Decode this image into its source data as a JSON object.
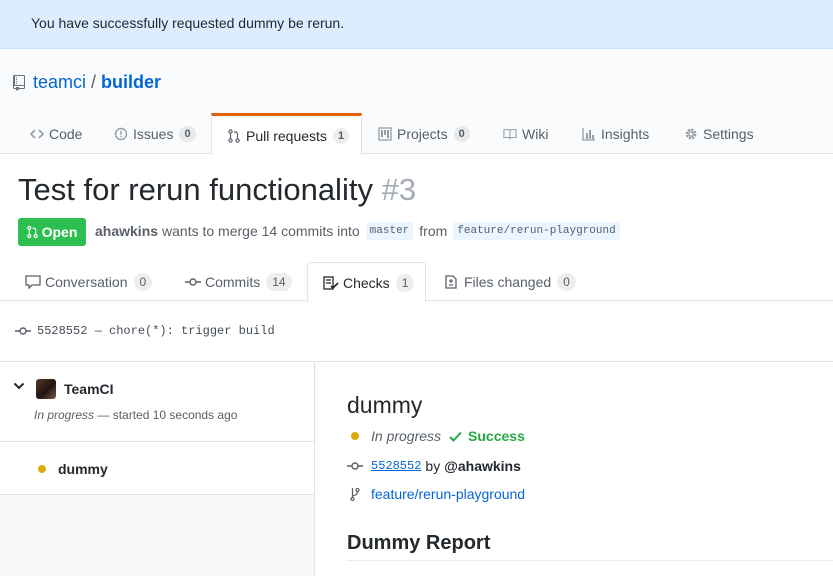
{
  "flash": {
    "message": "You have successfully requested dummy be rerun."
  },
  "repo": {
    "owner": "teamci",
    "separator": "/",
    "name": "builder"
  },
  "repo_nav": [
    {
      "label": "Code",
      "icon": "code-icon",
      "count": ""
    },
    {
      "label": "Issues",
      "icon": "issue-icon",
      "count": "0"
    },
    {
      "label": "Pull requests",
      "icon": "pull-request-icon",
      "count": "1",
      "selected": true
    },
    {
      "label": "Projects",
      "icon": "project-icon",
      "count": "0"
    },
    {
      "label": "Wiki",
      "icon": "book-icon",
      "count": ""
    },
    {
      "label": "Insights",
      "icon": "graph-icon",
      "count": ""
    },
    {
      "label": "Settings",
      "icon": "gear-icon",
      "count": ""
    }
  ],
  "pr": {
    "title": "Test for rerun functionality",
    "number": "#3",
    "state": "Open",
    "author": "ahawkins",
    "merge_text": "wants to merge 14 commits into",
    "base_branch": "master",
    "from_text": "from",
    "head_branch": "feature/rerun-playground"
  },
  "pr_tabs": [
    {
      "label": "Conversation",
      "icon": "comment-icon",
      "count": "0"
    },
    {
      "label": "Commits",
      "icon": "commit-icon",
      "count": "14"
    },
    {
      "label": "Checks",
      "icon": "checklist-icon",
      "count": "1",
      "selected": true
    },
    {
      "label": "Files changed",
      "icon": "file-diff-icon",
      "count": "0"
    }
  ],
  "commit": {
    "text": "5528552 — chore(*): trigger build"
  },
  "suite": {
    "name": "TeamCI",
    "status_italic": "In progress",
    "status_rest": " — started 10 seconds ago"
  },
  "run": {
    "name": "dummy"
  },
  "check": {
    "title": "dummy",
    "status": "In progress",
    "conclusion": "Success",
    "sha": "5528552",
    "by": "by",
    "user": "@ahawkins",
    "branch": "feature/rerun-playground",
    "report_title": "Dummy Report"
  },
  "colors": {
    "accent": "#0366d6",
    "success": "#28a745",
    "pending": "#dbab09",
    "open_badge": "#2cbe4e",
    "selected_tab_border": "#e36209",
    "flash_bg": "#dbedff"
  }
}
